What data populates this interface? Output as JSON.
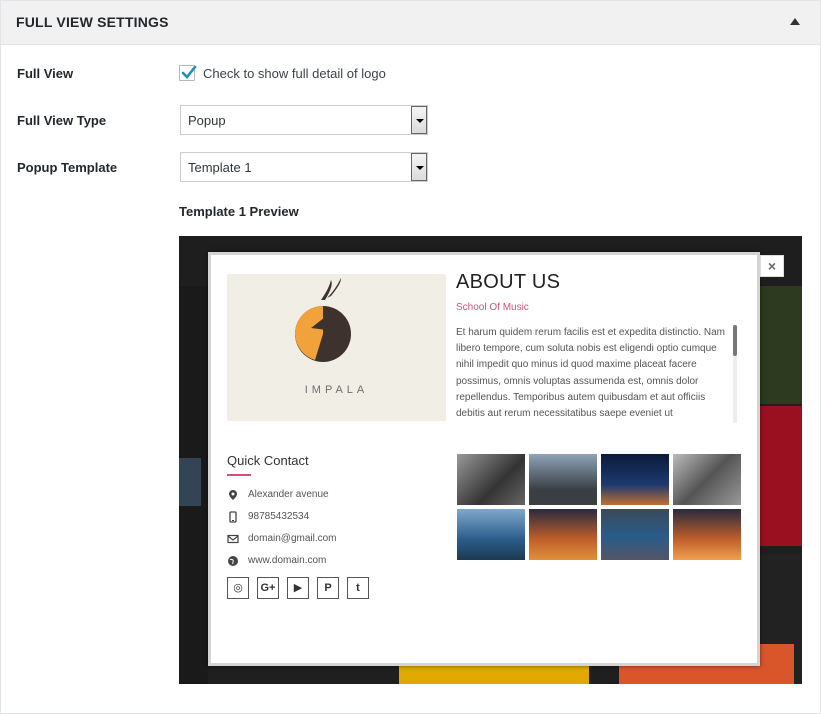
{
  "header": {
    "title": "FULL VIEW SETTINGS"
  },
  "full_view": {
    "label": "Full View",
    "checked": true,
    "checkbox_label": "Check to show full detail of logo"
  },
  "full_view_type": {
    "label": "Full View Type",
    "value": "Popup"
  },
  "popup_template": {
    "label": "Popup Template",
    "value": "Template 1"
  },
  "preview": {
    "label": "Template 1 Preview",
    "close_glyph": "×",
    "logo_text": "IMPALA",
    "about_title": "ABOUT US",
    "about_subtitle": "School Of Music",
    "about_body": "Et harum quidem rerum facilis est et expedita distinctio. Nam libero tempore, cum soluta nobis est eligendi optio cumque nihil impedit quo minus id quod maxime placeat facere possimus, omnis voluptas assumenda est, omnis dolor repellendus. Temporibus autem quibusdam et aut officiis debitis aut rerum necessitatibus saepe eveniet ut",
    "quick_contact": {
      "title": "Quick Contact",
      "address": "Alexander avenue",
      "phone": "98785432534",
      "email": "domain@gmail.com",
      "website": "www.domain.com"
    },
    "social": [
      {
        "icon": "instagram-icon",
        "glyph": "◎"
      },
      {
        "icon": "google-plus-icon",
        "glyph": "G+"
      },
      {
        "icon": "youtube-icon",
        "glyph": "▶"
      },
      {
        "icon": "pinterest-icon",
        "glyph": "P"
      },
      {
        "icon": "tumblr-icon",
        "glyph": "t"
      }
    ]
  },
  "colors": {
    "accent": "#d4507a",
    "header_bg": "#f1f1f1",
    "checkbox_check": "#1e8cbe"
  }
}
